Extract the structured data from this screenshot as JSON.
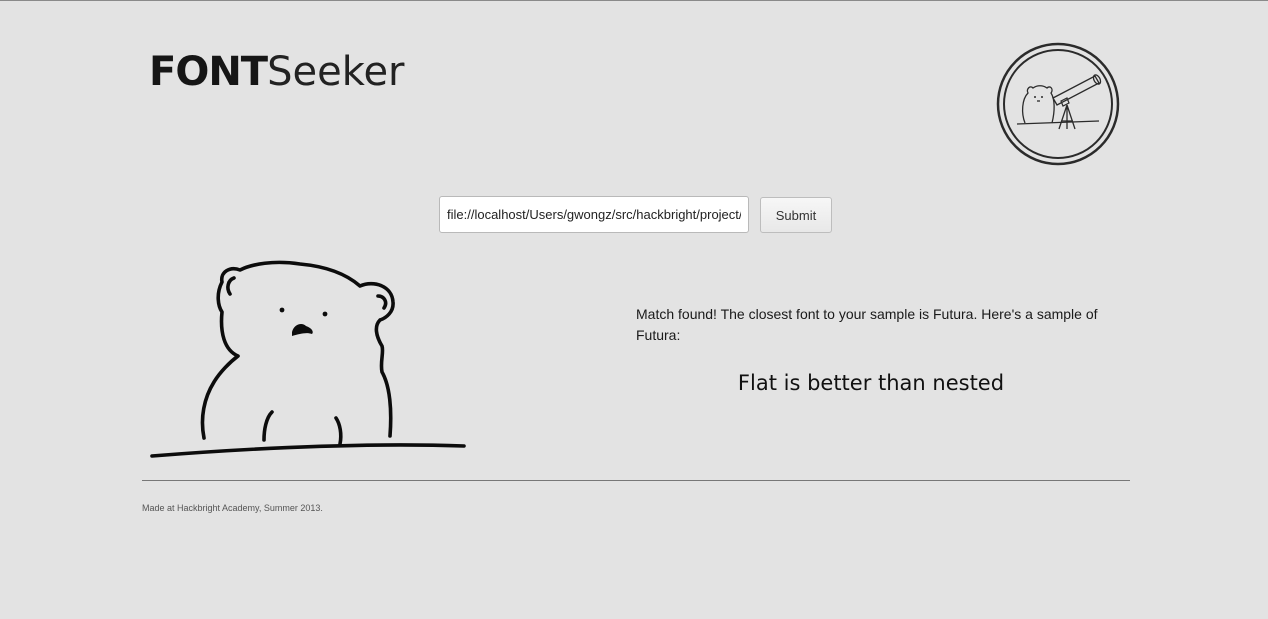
{
  "header": {
    "logo_bold": "FONT",
    "logo_light": "Seeker",
    "emblem_icon": "bear-telescope-emblem-icon"
  },
  "search": {
    "url_value": "file://localhost/Users/gwongz/src/hackbright/project/",
    "submit_label": "Submit"
  },
  "main": {
    "illustration_icon": "bear-illustration-icon",
    "result_message": "Match found! The closest font to your sample is Futura. Here's a sample of Futura:",
    "sample_text": "Flat is better than nested"
  },
  "footer": {
    "text": "Made at Hackbright Academy, Summer 2013."
  }
}
